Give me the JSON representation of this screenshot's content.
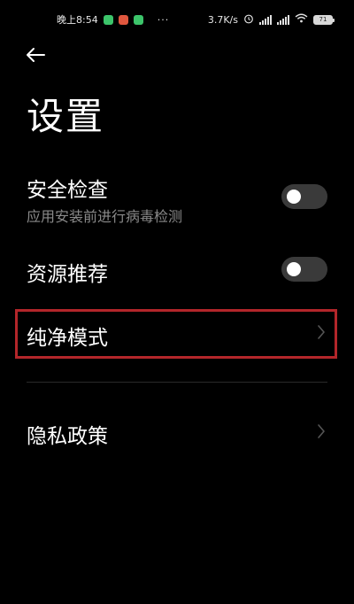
{
  "status_bar": {
    "time": "晚上8:54",
    "dots": "···",
    "net_speed": "3.7K/s",
    "battery": "71",
    "app_badge_colors": [
      "#3cc46a",
      "#e0573e",
      "#3cc46a"
    ]
  },
  "header": {
    "back_icon": "arrow-left-icon",
    "title": "设置"
  },
  "settings": {
    "security_check": {
      "title": "安全检查",
      "subtitle": "应用安装前进行病毒检测",
      "enabled": false
    },
    "resource_recommend": {
      "title": "资源推荐",
      "enabled": false
    },
    "pure_mode": {
      "title": "纯净模式",
      "icon": "chevron-right-icon"
    },
    "privacy_policy": {
      "title": "隐私政策",
      "icon": "chevron-right-icon"
    }
  },
  "colors": {
    "background": "#000000",
    "highlight": "#b3262a",
    "toggle_off": "#3a3a3a",
    "subtitle": "#8a8a8a"
  }
}
